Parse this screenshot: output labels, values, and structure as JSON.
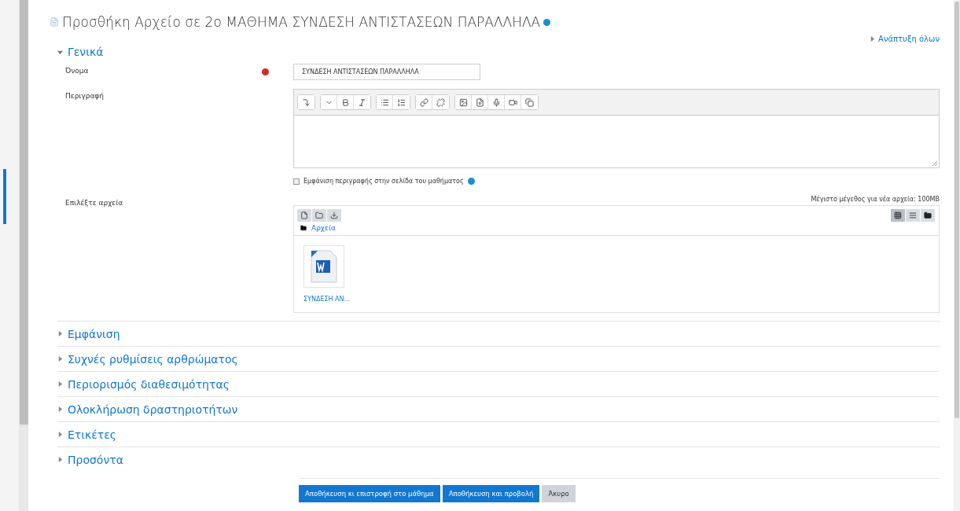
{
  "page_title": "Προσθήκη Αρχείο σε 2ο ΜΑΘΗΜΑ ΣΥΝΔΕΣΗ ΑΝΤΙΣΤΑΣΕΩΝ ΠΑΡΑΛΛΗΛΑ",
  "expand_all": "Ανάπτυξη όλων",
  "general": {
    "title": "Γενικά",
    "expanded": true,
    "name_label": "Όνομα",
    "name_value": "ΣΥΝΔΕΣΗ ΑΝΤΙΣΤΑΣΕΩΝ ΠΑΡΑΛΛΗΛΑ",
    "required": true,
    "description_label": "Περιγραφή",
    "show_description": {
      "label": "Εμφάνιση περιγραφής στην σελίδα του μαθήματος",
      "checked": false
    },
    "files_label": "Επιλέξτε αρχεία",
    "max_size": "Μέγιστο μέγεθος για νέα αρχεία: 100MB",
    "views": [
      {
        "kind": "grid",
        "selected": true
      },
      {
        "kind": "list",
        "selected": false
      },
      {
        "kind": "tree",
        "selected": false
      }
    ],
    "folder": "Αρχεία",
    "files": [
      {
        "name": "ΣΥΝΔΕΣΗ ΑΝ..."
      }
    ]
  },
  "sections": [
    {
      "title": "Εμφάνιση",
      "expanded": false
    },
    {
      "title": "Συχνές ρυθμίσεις αρθρώματος",
      "expanded": false
    },
    {
      "title": "Περιορισμός διαθεσιμότητας",
      "expanded": false
    },
    {
      "title": "Ολοκλήρωση δραστηριοτήτων",
      "expanded": false
    },
    {
      "title": "Ετικέτες",
      "expanded": false
    },
    {
      "title": "Προσόντα",
      "expanded": false
    }
  ],
  "buttons": [
    {
      "label": "Αποθήκευση κι επιστροφή στο μάθημα",
      "kind": "primary"
    },
    {
      "label": "Αποθήκευση και προβολή",
      "kind": "primary"
    },
    {
      "label": "Άκυρο",
      "kind": "secondary"
    }
  ]
}
